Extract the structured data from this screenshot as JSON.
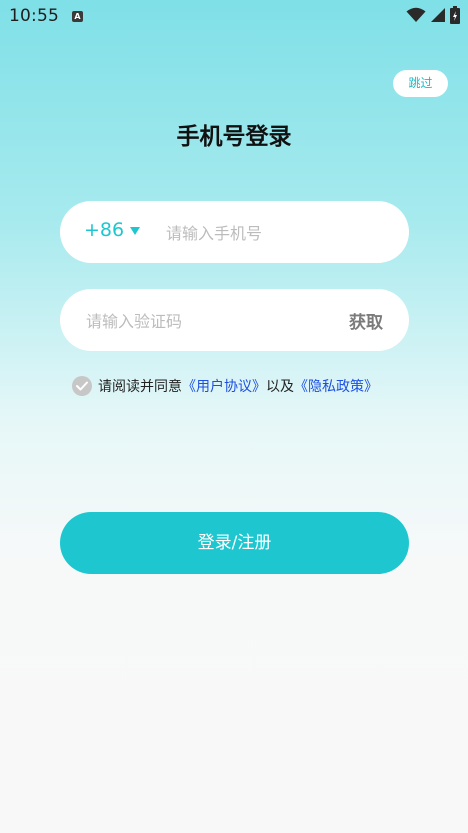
{
  "status_bar": {
    "time": "10:55",
    "notification_icon": "A"
  },
  "skip_label": "跳过",
  "title": "手机号登录",
  "phone": {
    "country_code": "+86",
    "placeholder": "请输入手机号"
  },
  "code": {
    "placeholder": "请输入验证码",
    "get_label": "获取"
  },
  "agreement": {
    "prefix": "请阅读并同意",
    "user_agreement": "《用户协议》",
    "middle": "以及",
    "privacy_policy": "《隐私政策》"
  },
  "login_label": "登录/注册",
  "colors": {
    "accent": "#1ec7cf",
    "link": "#1d4fe0",
    "check": "#c7c7c7"
  }
}
